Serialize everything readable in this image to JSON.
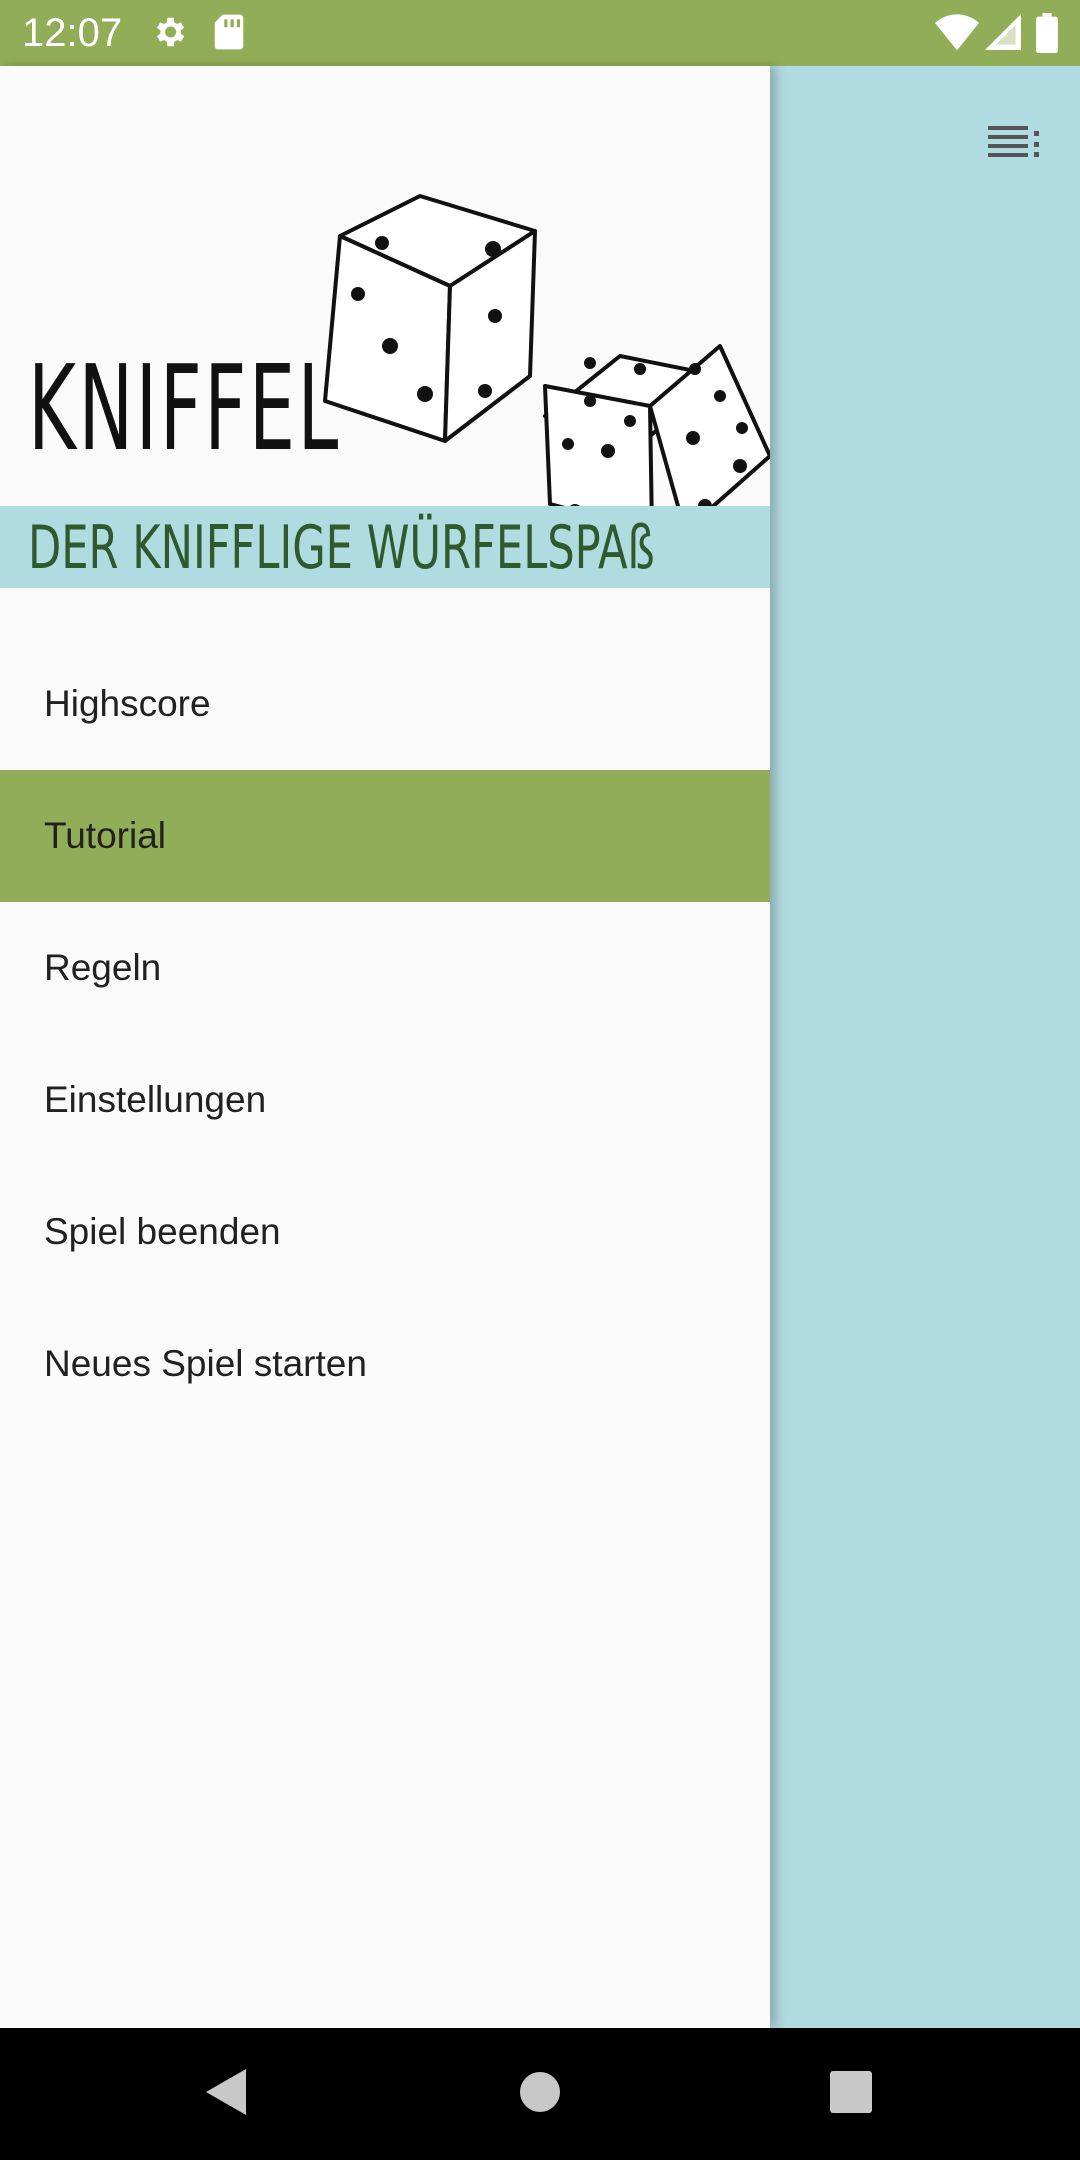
{
  "status_bar": {
    "time": "12:07"
  },
  "drawer": {
    "title": "KNIFFEL",
    "subtitle": "DER KNIFFLIGE WÜRFELSPAß",
    "items": [
      {
        "label": "Highscore",
        "selected": false
      },
      {
        "label": "Tutorial",
        "selected": true
      },
      {
        "label": "Regeln",
        "selected": false
      },
      {
        "label": "Einstellungen",
        "selected": false
      },
      {
        "label": "Spiel beenden",
        "selected": false
      },
      {
        "label": "Neues Spiel starten",
        "selected": false
      }
    ]
  },
  "colors": {
    "accent_green": "#92ad57",
    "light_blue": "#b0dbe0",
    "drawer_bg": "#fafafa",
    "subtitle_green": "#2f5a2e"
  },
  "icons": {
    "status": [
      "gear-icon",
      "sd-card-icon",
      "wifi-icon",
      "signal-icon",
      "battery-icon"
    ],
    "toolbar": [
      "overflow-menu-icon"
    ],
    "nav": [
      "back-icon",
      "home-icon",
      "recents-icon"
    ]
  }
}
